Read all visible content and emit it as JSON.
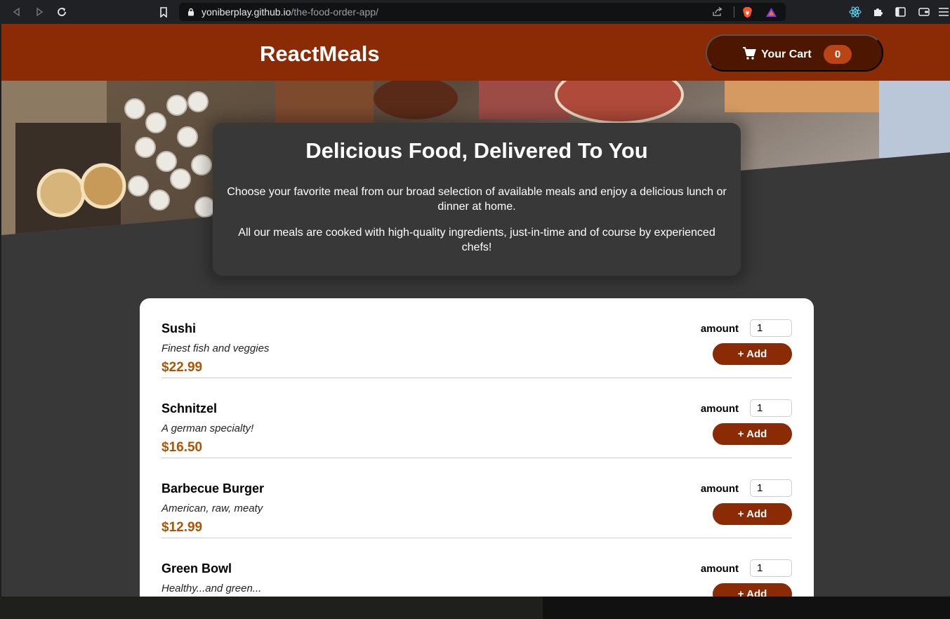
{
  "browser": {
    "url_host": "yoniberplay.github.io",
    "url_path": "/the-food-order-app/"
  },
  "header": {
    "brand": "ReactMeals",
    "cart_label": "Your Cart",
    "cart_count": "0"
  },
  "summary": {
    "title": "Delicious Food, Delivered To You",
    "paragraph1": "Choose your favorite meal from our broad selection of available meals and enjoy a delicious lunch or dinner at home.",
    "paragraph2": "All our meals are cooked with high-quality ingredients, just-in-time and of course by experienced chefs!"
  },
  "meals": [
    {
      "name": "Sushi",
      "description": "Finest fish and veggies",
      "price": "$22.99",
      "amount_label": "amount",
      "amount": "1",
      "add_label": "+ Add"
    },
    {
      "name": "Schnitzel",
      "description": "A german specialty!",
      "price": "$16.50",
      "amount_label": "amount",
      "amount": "1",
      "add_label": "+ Add"
    },
    {
      "name": "Barbecue Burger",
      "description": "American, raw, meaty",
      "price": "$12.99",
      "amount_label": "amount",
      "amount": "1",
      "add_label": "+ Add"
    },
    {
      "name": "Green Bowl",
      "description": "Healthy...and green...",
      "price": "",
      "amount_label": "amount",
      "amount": "1",
      "add_label": "+ Add"
    }
  ],
  "colors": {
    "header": "#8a2b06",
    "cart_button": "#4d1601",
    "badge": "#b94517",
    "price": "#ad5502"
  }
}
